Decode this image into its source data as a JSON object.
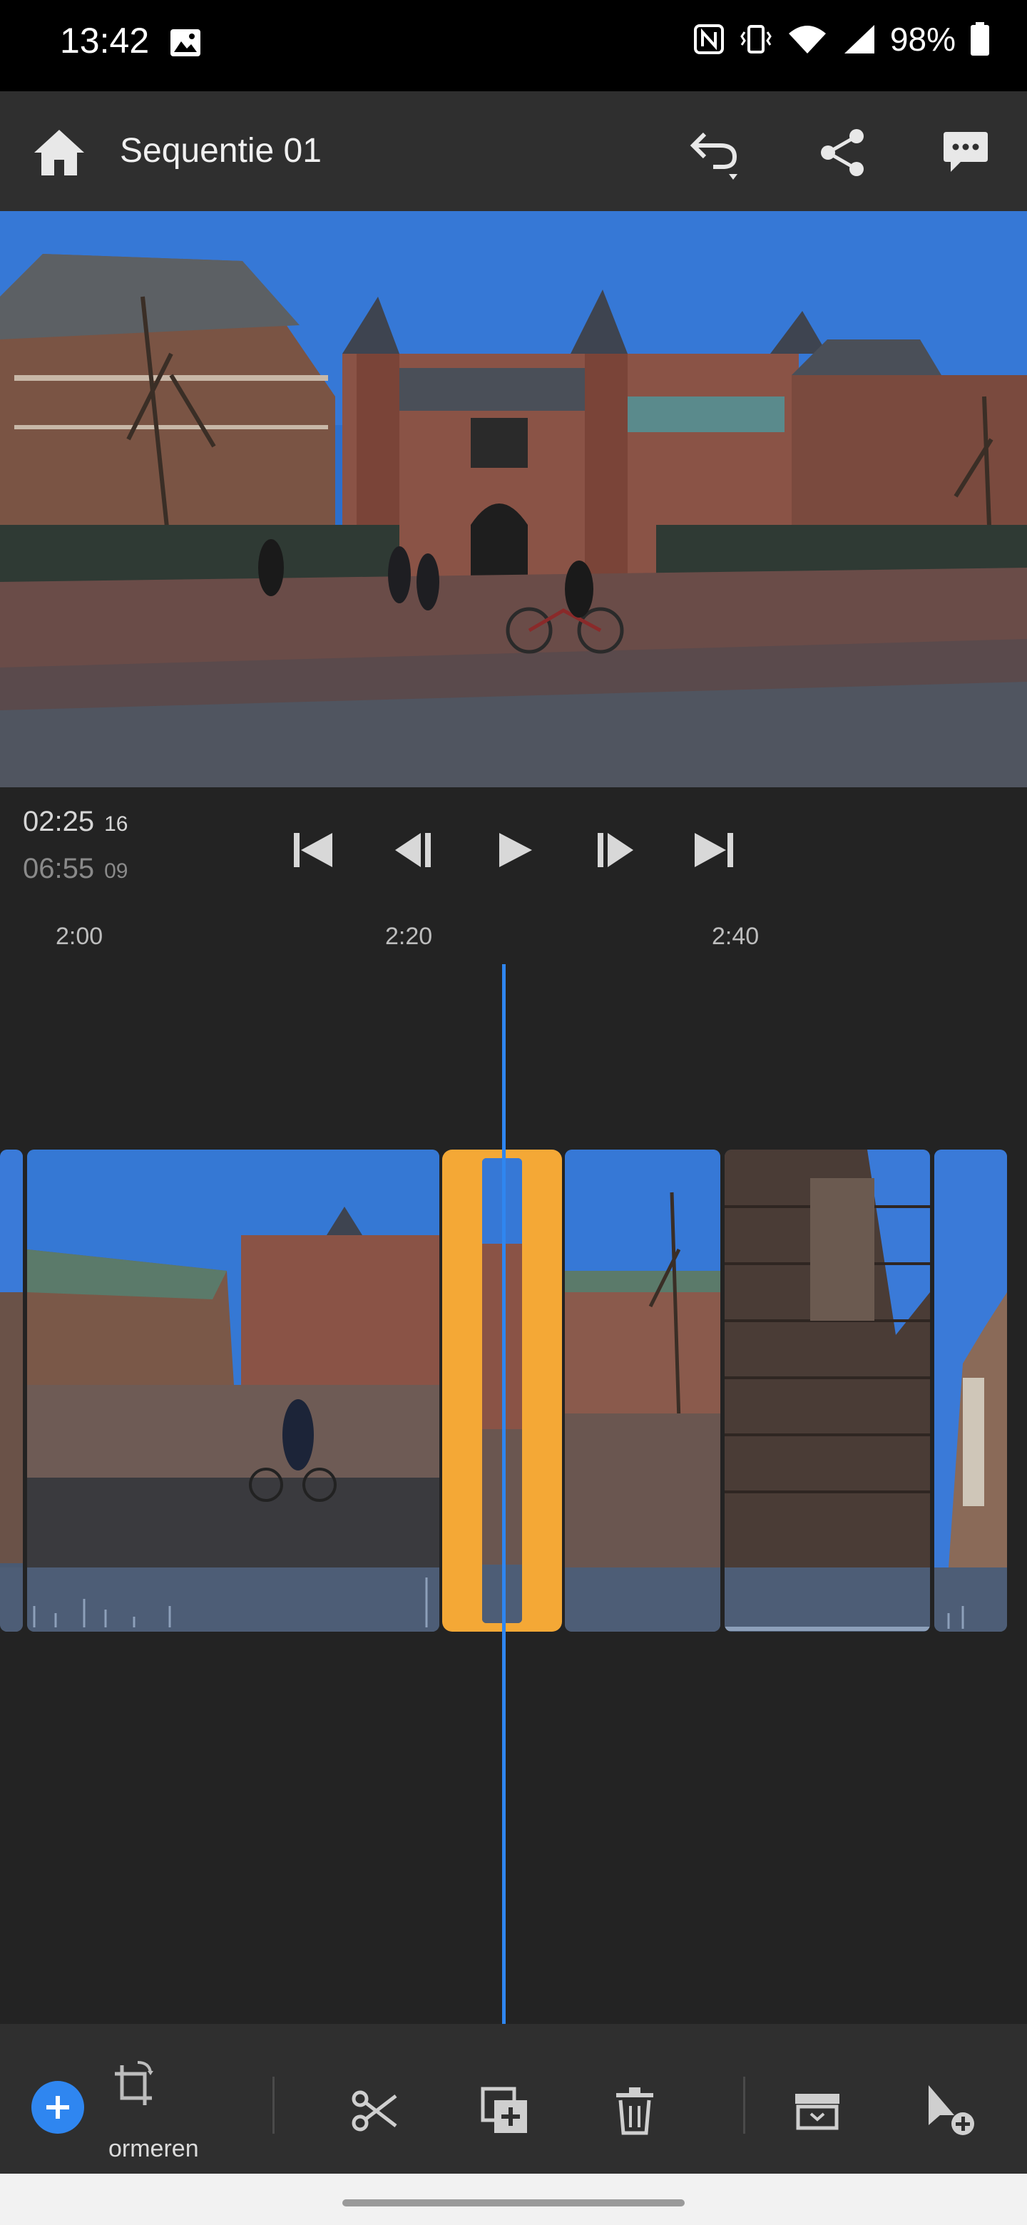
{
  "status_bar": {
    "time": "13:42",
    "battery": "98%"
  },
  "app_bar": {
    "title": "Sequentie 01"
  },
  "transport": {
    "current_time": "02:25",
    "current_frames": "16",
    "total_time": "06:55",
    "total_frames": "09"
  },
  "ruler": {
    "ticks": [
      "2:00",
      "2:20",
      "2:40"
    ]
  },
  "toolbar": {
    "transform_label": "ormeren"
  },
  "colors": {
    "accent": "#2f86f0",
    "selection": "#f4a836",
    "background": "#232323"
  }
}
